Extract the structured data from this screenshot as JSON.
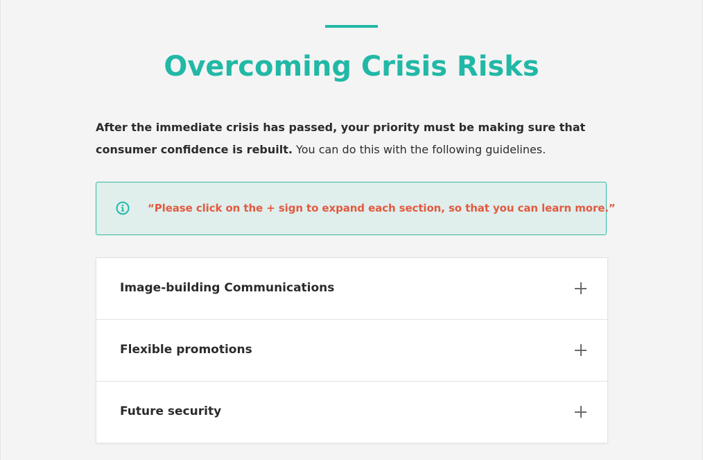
{
  "header": {
    "title": "Overcoming Crisis Risks"
  },
  "intro": {
    "bold_text": "After the immediate crisis has passed, your priority must be making sure that consumer confidence is rebuilt.",
    "regular_text": " You can do this with the following guidelines."
  },
  "notice": {
    "icon": "info-circle-icon",
    "text": "“Please click on the + sign to expand each section, so that you can learn more.”"
  },
  "accordion": {
    "items": [
      {
        "label": "Image-building Communications",
        "icon": "plus-icon",
        "expanded": false
      },
      {
        "label": "Flexible promotions",
        "icon": "plus-icon",
        "expanded": false
      },
      {
        "label": "Future security",
        "icon": "plus-icon",
        "expanded": false
      }
    ]
  },
  "colors": {
    "accent": "#22b8a6",
    "notice_background": "#e0eeec",
    "notice_border": "#34b8a2",
    "notice_text": "#e25a3f",
    "page_background": "#f4f4f4",
    "body_text": "#2d2d2d"
  }
}
